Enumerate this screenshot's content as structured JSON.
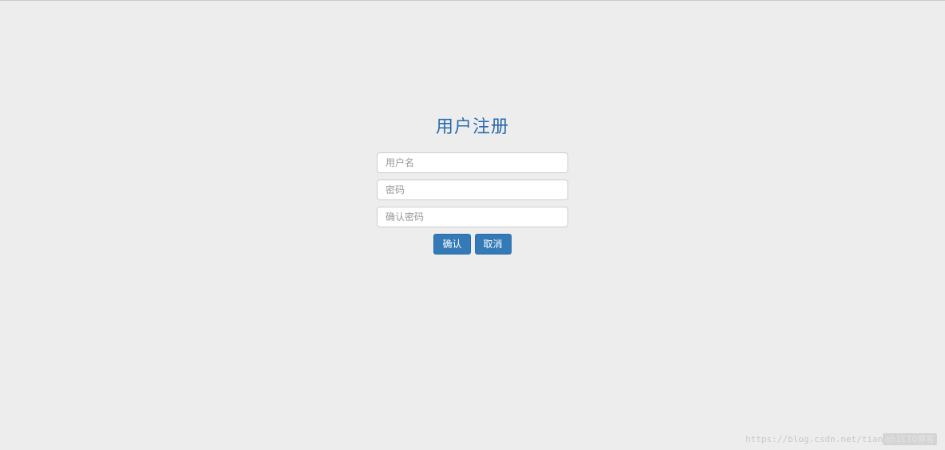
{
  "form": {
    "title": "用户注册",
    "username_placeholder": "用户名",
    "password_placeholder": "密码",
    "confirm_password_placeholder": "确认密码",
    "submit_label": "确认",
    "cancel_label": "取消"
  },
  "watermark": {
    "text": "https://blog.csdn.net/tian",
    "badge": "@51CTO博客"
  }
}
